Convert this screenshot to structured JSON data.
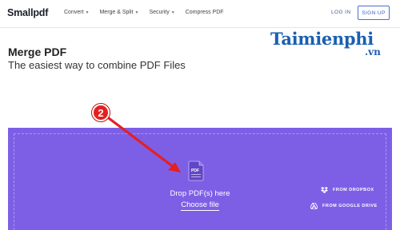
{
  "header": {
    "logo": "Smallpdf",
    "nav": [
      {
        "label": "Convert",
        "has_dropdown": true
      },
      {
        "label": "Merge & Split",
        "has_dropdown": true
      },
      {
        "label": "Security",
        "has_dropdown": true
      },
      {
        "label": "Compress PDF",
        "has_dropdown": false
      }
    ],
    "login_label": "LOG IN",
    "signup_label": "SIGN UP"
  },
  "main": {
    "title": "Merge PDF",
    "subtitle": "The easiest way to combine PDF Files"
  },
  "watermark": {
    "text": "Taimienphi",
    "suffix": ".vn"
  },
  "dropzone": {
    "icon_label": "PDF",
    "drop_text": "Drop PDF(s) here",
    "choose_label": "Choose file",
    "from_dropbox": "FROM DROPBOX",
    "from_google_drive": "FROM GOOGLE DRIVE",
    "bg_color": "#7d5fe6"
  },
  "annotation": {
    "step": "2",
    "color": "#e61f1f"
  }
}
